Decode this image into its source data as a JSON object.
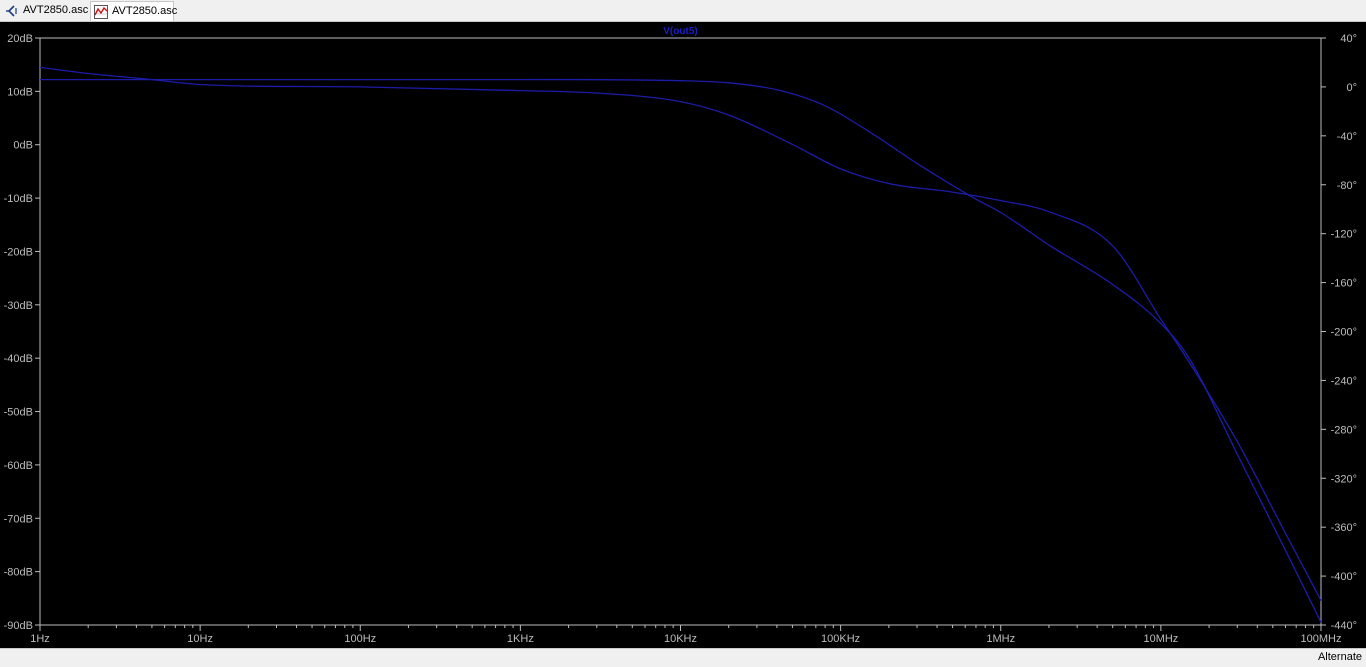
{
  "tabs": [
    {
      "label": "AVT2850.asc",
      "icon": "schematic-icon"
    },
    {
      "label": "AVT2850.asc",
      "icon": "waveform-icon"
    }
  ],
  "status": {
    "text": "Alternate"
  },
  "colors": {
    "background": "#000000",
    "trace": "#1c1ca8",
    "axis": "#bcbcbc",
    "title": "#1c1cc8"
  },
  "chart_data": {
    "type": "line",
    "title": "V(out5)",
    "xscale": "log",
    "xlim": [
      1,
      100000000
    ],
    "ylim": [
      -90,
      20
    ],
    "y2lim": [
      -440,
      40
    ],
    "x_ticks": [
      {
        "v": 1,
        "label": "1Hz"
      },
      {
        "v": 10,
        "label": "10Hz"
      },
      {
        "v": 100,
        "label": "100Hz"
      },
      {
        "v": 1000,
        "label": "1KHz"
      },
      {
        "v": 10000,
        "label": "10KHz"
      },
      {
        "v": 100000,
        "label": "100KHz"
      },
      {
        "v": 1000000,
        "label": "1MHz"
      },
      {
        "v": 10000000,
        "label": "10MHz"
      },
      {
        "v": 100000000,
        "label": "100MHz"
      }
    ],
    "y_ticks": [
      {
        "v": 20,
        "label": "20dB"
      },
      {
        "v": 10,
        "label": "10dB"
      },
      {
        "v": 0,
        "label": "0dB"
      },
      {
        "v": -10,
        "label": "-10dB"
      },
      {
        "v": -20,
        "label": "-20dB"
      },
      {
        "v": -30,
        "label": "-30dB"
      },
      {
        "v": -40,
        "label": "-40dB"
      },
      {
        "v": -50,
        "label": "-50dB"
      },
      {
        "v": -60,
        "label": "-60dB"
      },
      {
        "v": -70,
        "label": "-70dB"
      },
      {
        "v": -80,
        "label": "-80dB"
      },
      {
        "v": -90,
        "label": "-90dB"
      }
    ],
    "y2_ticks": [
      {
        "v": 40,
        "label": "40°"
      },
      {
        "v": 0,
        "label": "0°"
      },
      {
        "v": -40,
        "label": "-40°"
      },
      {
        "v": -80,
        "label": "-80°"
      },
      {
        "v": -120,
        "label": "-120°"
      },
      {
        "v": -160,
        "label": "-160°"
      },
      {
        "v": -200,
        "label": "-200°"
      },
      {
        "v": -240,
        "label": "-240°"
      },
      {
        "v": -280,
        "label": "-280°"
      },
      {
        "v": -320,
        "label": "-320°"
      },
      {
        "v": -360,
        "label": "-360°"
      },
      {
        "v": -400,
        "label": "-400°"
      },
      {
        "v": -440,
        "label": "-440°"
      }
    ],
    "series": [
      {
        "axis": "left",
        "x": [
          1,
          2,
          5,
          10,
          100,
          1000,
          10000,
          20000,
          40000,
          80000,
          150000,
          300000,
          700000,
          1000000,
          2000000,
          5000000,
          10000000,
          15000000,
          30000000,
          60000000,
          100000000
        ],
        "y": [
          12.2,
          12.2,
          12.2,
          12.2,
          12.2,
          12.2,
          12.0,
          11.6,
          10.3,
          7.3,
          2.5,
          -3.5,
          -10.2,
          -12.7,
          -18.8,
          -26.2,
          -33.5,
          -40.0,
          -58.0,
          -76.0,
          -89.5
        ]
      },
      {
        "axis": "right",
        "x": [
          1,
          2,
          5,
          10,
          100,
          1000,
          3000,
          10000,
          20000,
          50000,
          100000,
          200000,
          500000,
          1000000,
          2000000,
          5000000,
          10000000,
          15000000,
          30000000,
          60000000,
          100000000
        ],
        "y": [
          16,
          11,
          6,
          2,
          0,
          -3,
          -5,
          -12,
          -23,
          -47,
          -67,
          -79,
          -86,
          -93,
          -102,
          -130,
          -190,
          -225,
          -290,
          -365,
          -420
        ]
      }
    ]
  }
}
